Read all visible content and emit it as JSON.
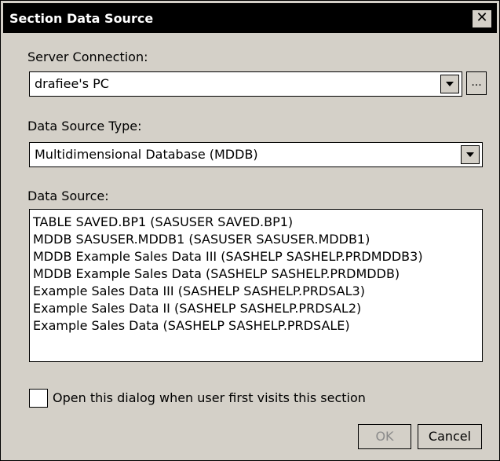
{
  "window": {
    "title": "Section Data Source"
  },
  "server_connection": {
    "label": "Server Connection:",
    "value": "drafiee's PC",
    "browse": "..."
  },
  "data_source_type": {
    "label": "Data Source Type:",
    "value": "Multidimensional Database (MDDB)"
  },
  "data_source": {
    "label": "Data Source:",
    "items": [
      "TABLE SAVED.BP1 (SASUSER SAVED.BP1)",
      "MDDB SASUSER.MDDB1 (SASUSER SASUSER.MDDB1)",
      "MDDB Example Sales Data III (SASHELP SASHELP.PRDMDDB3)",
      "MDDB Example Sales Data (SASHELP SASHELP.PRDMDDB)",
      "Example Sales Data III (SASHELP SASHELP.PRDSAL3)",
      "Example Sales Data II (SASHELP SASHELP.PRDSAL2)",
      "Example Sales Data (SASHELP SASHELP.PRDSALE)"
    ]
  },
  "option": {
    "label": "Open this dialog when user first visits this section",
    "checked": false
  },
  "buttons": {
    "ok": "OK",
    "cancel": "Cancel"
  },
  "icons": {
    "close": "close-icon",
    "dropdown": "chevron-down-icon"
  }
}
